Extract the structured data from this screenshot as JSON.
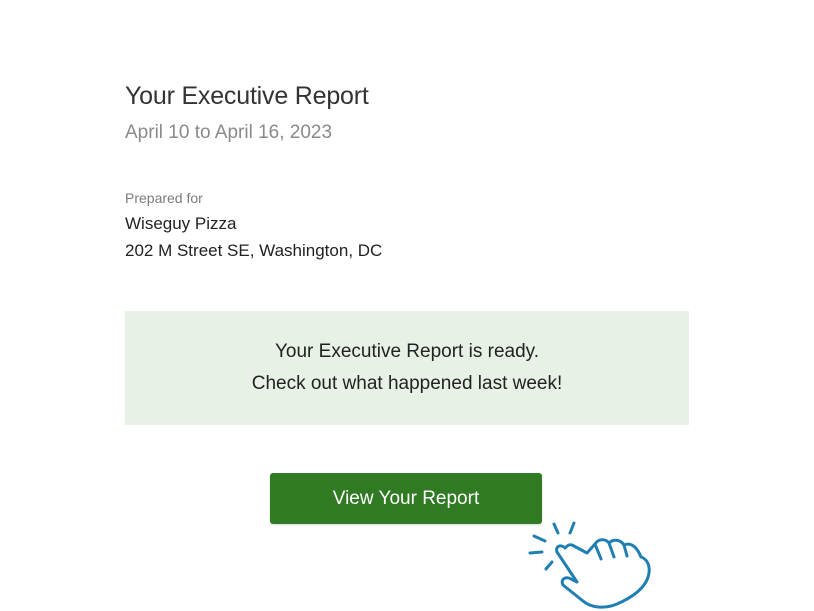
{
  "report": {
    "title": "Your Executive Report",
    "date_range": "April 10 to April 16, 2023"
  },
  "prepared_for": {
    "label": "Prepared for",
    "name": "Wiseguy Pizza",
    "address": "202 M Street SE, Washington, DC"
  },
  "notice": {
    "line1": "Your Executive Report is ready.",
    "line2": "Check out what happened last week!"
  },
  "cta": {
    "label": "View Your Report"
  },
  "colors": {
    "button_green": "#2f7a22",
    "notice_background": "#e8f1e6",
    "cursor_blue": "#1f7fb3"
  },
  "icons": {
    "cursor": "hand-pointer-icon"
  }
}
